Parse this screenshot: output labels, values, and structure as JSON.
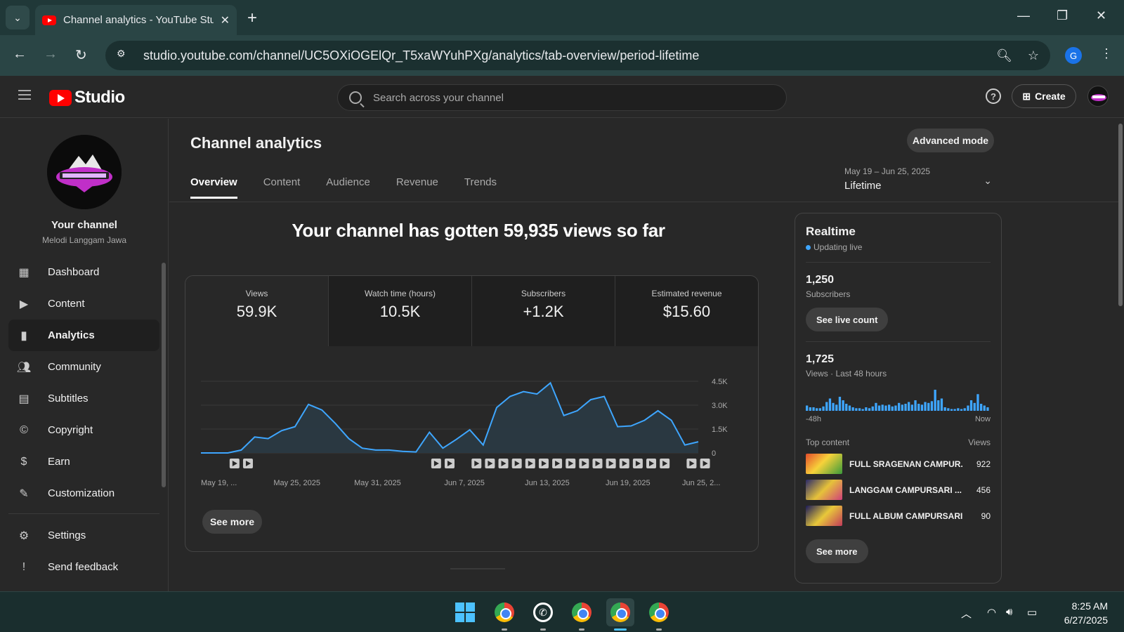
{
  "browser": {
    "tab_title": "Channel analytics - YouTube Stu",
    "url": "studio.youtube.com/channel/UC5OXiOGElQr_T5xaWYuhPXg/analytics/tab-overview/period-lifetime",
    "profile_initial": "G"
  },
  "header": {
    "logo_text": "Studio",
    "search_placeholder": "Search across your channel",
    "create_label": "Create"
  },
  "sidebar": {
    "channel_label": "Your channel",
    "channel_name": "Melodi Langgam Jawa",
    "items": [
      {
        "label": "Dashboard",
        "icon": "dashboard-icon"
      },
      {
        "label": "Content",
        "icon": "content-icon"
      },
      {
        "label": "Analytics",
        "icon": "analytics-icon",
        "active": true
      },
      {
        "label": "Community",
        "icon": "community-icon"
      },
      {
        "label": "Subtitles",
        "icon": "subtitles-icon"
      },
      {
        "label": "Copyright",
        "icon": "copyright-icon"
      },
      {
        "label": "Earn",
        "icon": "earn-icon"
      },
      {
        "label": "Customization",
        "icon": "customization-icon"
      }
    ],
    "bottom_items": [
      {
        "label": "Settings",
        "icon": "gear-icon"
      },
      {
        "label": "Send feedback",
        "icon": "feedback-icon"
      }
    ]
  },
  "main": {
    "title": "Channel analytics",
    "advanced_mode_label": "Advanced mode",
    "tabs": [
      "Overview",
      "Content",
      "Audience",
      "Revenue",
      "Trends"
    ],
    "period": {
      "range": "May 19 – Jun 25, 2025",
      "value": "Lifetime"
    },
    "headline": "Your channel has gotten 59,935 views so far",
    "metrics": [
      {
        "label": "Views",
        "value": "59.9K"
      },
      {
        "label": "Watch time (hours)",
        "value": "10.5K"
      },
      {
        "label": "Subscribers",
        "value": "+1.2K"
      },
      {
        "label": "Estimated revenue",
        "value": "$15.60"
      }
    ],
    "see_more_label": "See more"
  },
  "chart_data": {
    "type": "area",
    "title": "",
    "xlabel": "",
    "ylabel": "",
    "x_tick_labels": [
      "May 19, ...",
      "May 25, 2025",
      "May 31, 2025",
      "Jun 7, 2025",
      "Jun 13, 2025",
      "Jun 19, 2025",
      "Jun 25, 2..."
    ],
    "y_tick_labels": [
      "4.5K",
      "3.0K",
      "1.5K",
      "0"
    ],
    "ylim": [
      0,
      4500
    ],
    "series": [
      {
        "values": [
          0,
          0,
          0,
          180,
          1000,
          900,
          1400,
          1650,
          3050,
          2700,
          1850,
          900,
          300,
          180,
          180,
          100,
          60,
          1300,
          300,
          850,
          1450,
          500,
          2850,
          3550,
          3850,
          3700,
          4400,
          2350,
          2650,
          3350,
          3550,
          1650,
          1700,
          2050,
          2650,
          2050,
          500,
          700
        ]
      }
    ],
    "video_markers": [
      2,
      3,
      17,
      18,
      20,
      21,
      22,
      23,
      24,
      25,
      26,
      27,
      28,
      29,
      30,
      31,
      32,
      33,
      34,
      36,
      37
    ],
    "colors": {
      "line": "#3ea6ff",
      "fill": "#2a3a44",
      "grid": "#3a3a3a"
    }
  },
  "realtime": {
    "title": "Realtime",
    "status": "Updating live",
    "subscribers_value": "1,250",
    "subscribers_label": "Subscribers",
    "see_live_label": "See live count",
    "views_value": "1,725",
    "views_label": "Views · Last 48 hours",
    "axis_start": "-48h",
    "axis_end": "Now",
    "bars": [
      6,
      4,
      4,
      3,
      3,
      5,
      10,
      14,
      9,
      7,
      16,
      12,
      8,
      6,
      4,
      3,
      3,
      2,
      4,
      3,
      5,
      9,
      6,
      7,
      6,
      7,
      5,
      6,
      9,
      7,
      8,
      10,
      7,
      12,
      8,
      7,
      10,
      9,
      11,
      24,
      12,
      14,
      4,
      3,
      2,
      2,
      3,
      2,
      3,
      6,
      12,
      9,
      19,
      8,
      6,
      4
    ],
    "top_content_label": "Top content",
    "top_views_label": "Views",
    "top_content": [
      {
        "title": "FULL SRAGENAN CAMPUR...",
        "views": "922"
      },
      {
        "title": "LANGGAM CAMPURSARI ...",
        "views": "456"
      },
      {
        "title": "FULL ALBUM CAMPURSARI ...",
        "views": "90"
      }
    ],
    "see_more_label": "See more"
  },
  "taskbar": {
    "time": "8:25 AM",
    "date": "6/27/2025"
  }
}
